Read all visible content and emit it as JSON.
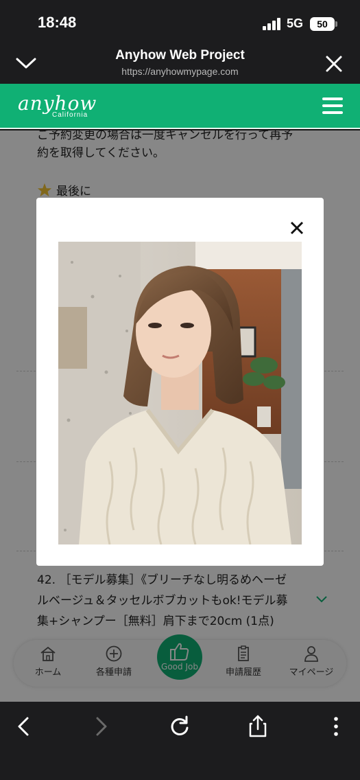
{
  "status": {
    "time": "18:48",
    "network": "5G",
    "battery": "50"
  },
  "browser": {
    "title": "Anyhow Web Project",
    "url": "https://anyhowmypage.com"
  },
  "site": {
    "logo": "anyhow",
    "logo_sub": "California"
  },
  "content": {
    "para1_line1": "ご予約変更の場合は一度キャンセルを行って再予",
    "para1_line2": "約を取得してください。",
    "section_heading": "最後に",
    "item42_line1": "42. ［モデル募集］《ブリーチなし明るめヘーゼ",
    "item42_line2": "ルベージュ＆タッセルボブカットもok!モデル募",
    "item42_line3": "集+シャンプー［無料］肩下まで20cm (1点)"
  },
  "bottom_nav": {
    "home": "ホーム",
    "apply": "各種申請",
    "good_job": "Good Job",
    "history": "申請履歴",
    "mypage": "マイページ"
  },
  "colors": {
    "brand_green": "#10b074",
    "browser_chrome": "#1c1c1e"
  },
  "icons": [
    "chevron-down-icon",
    "close-icon",
    "hamburger-menu-icon",
    "star-icon",
    "home-icon",
    "plus-circle-icon",
    "thumbs-up-icon",
    "clipboard-icon",
    "person-icon",
    "back-icon",
    "forward-icon",
    "reload-icon",
    "share-icon",
    "more-icon"
  ]
}
